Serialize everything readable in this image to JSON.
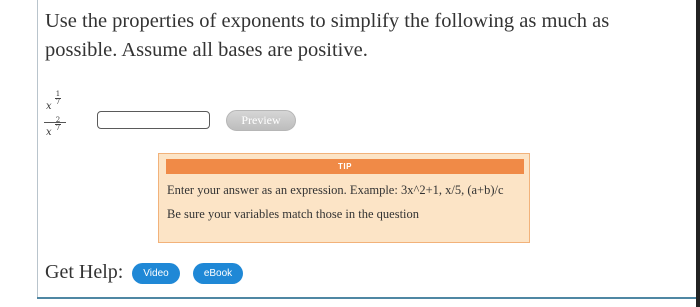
{
  "question": {
    "text": "Use the properties of exponents to simplify the following as much as possible. Assume all bases are positive."
  },
  "expression": {
    "numerator_base": "x",
    "numerator_exp_num": "1",
    "numerator_exp_den": "7",
    "denominator_base": "x",
    "denominator_exp_num": "2",
    "denominator_exp_den": "7",
    "equals": "="
  },
  "answer": {
    "value": "",
    "placeholder": ""
  },
  "preview": {
    "label": "Preview"
  },
  "tip": {
    "header": "TIP",
    "line1": "Enter your answer as an expression. Example: 3x^2+1, x/5, (a+b)/c",
    "line2": "Be sure your variables match those in the question"
  },
  "help": {
    "label": "Get Help:",
    "video_label": "Video",
    "ebook_label": "eBook"
  },
  "colors": {
    "tip_header": "#f08a47",
    "tip_background": "#fce4c6",
    "help_button": "#1f88d6",
    "panel_rule": "#4f87a3"
  }
}
